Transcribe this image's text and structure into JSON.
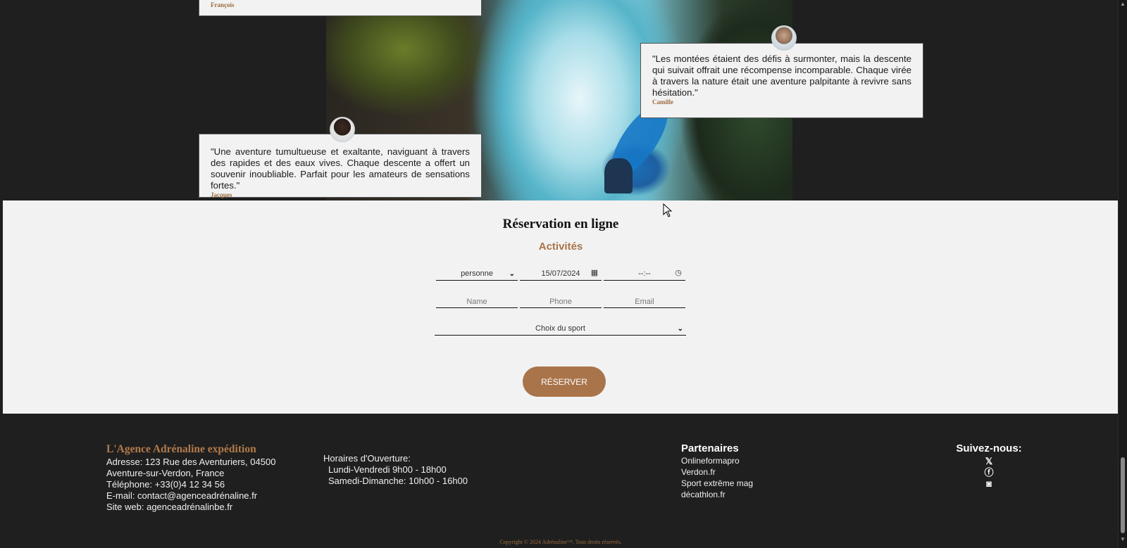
{
  "testimonials": {
    "top": {
      "author": "François"
    },
    "right": {
      "text": "\"Les montées étaient des défis à surmonter, mais la descente qui suivait offrait une récompense incomparable. Chaque virée à travers la nature était une aventure palpitante à revivre sans hésitation.\"",
      "author": "Camille"
    },
    "left": {
      "text": "\"Une aventure tumultueuse et exaltante, naviguant à travers des rapides et des eaux vives. Chaque descente a offert un souvenir inoubliable. Parfait pour les amateurs de sensations fortes.\"",
      "author": "Jacques"
    }
  },
  "booking": {
    "title": "Réservation en ligne",
    "subtitle": "Activités",
    "person_select": "personne",
    "date_value": "15/07/2024",
    "time_value": "--:--",
    "name_placeholder": "Name",
    "phone_placeholder": "Phone",
    "email_placeholder": "Email",
    "sport_select": "Choix du sport",
    "reserve_label": "RÉSERVER"
  },
  "footer": {
    "brand": "L'Agence Adrénaline expédition",
    "address": "Adresse: 123 Rue des Aventuriers, 04500 Aventure-sur-Verdon, France",
    "phone": "Téléphone: +33(0)4 12 34 56",
    "email": "E-mail: contact@agenceadrénaline.fr",
    "website": "Site web: agenceadrénalinbe.fr",
    "hours_title": "Horaires d'Ouverture:",
    "hours_week": "Lundi-Vendredi 9h00 - 18h00",
    "hours_weekend": "Samedi-Dimanche: 10h00 - 16h00",
    "partners_title": "Partenaires",
    "partners": [
      "Onlineformapro",
      "Verdon.fr",
      "Sport extrême mag",
      "décathlon.fr"
    ],
    "follow_title": "Suivez-nous:",
    "social_icons": [
      "x-icon",
      "facebook-icon",
      "instagram-icon"
    ],
    "copyright": "Copyright © 2024 Adrénaline™. Tous droits réservés."
  },
  "colors": {
    "accent": "#a9744a",
    "footer_bg": "#1f1f1f",
    "booking_bg": "#f2f2f2"
  }
}
